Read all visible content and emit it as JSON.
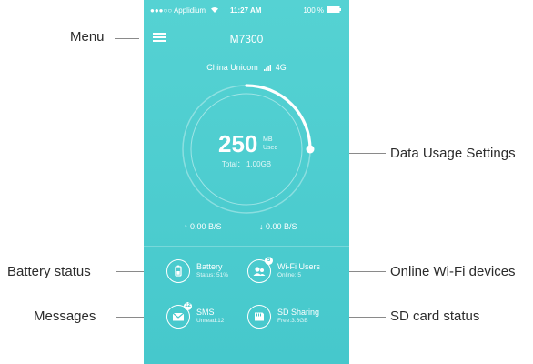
{
  "status_bar": {
    "carrier": "●●●○○ Applidium",
    "time": "11:27 AM",
    "battery": "100 %"
  },
  "header": {
    "title": "M7300"
  },
  "network": {
    "carrier": "China Unicom",
    "type": "4G"
  },
  "usage": {
    "value": "250",
    "unit": "MB",
    "used_label": "Used",
    "total": "Total： 1.00GB",
    "fraction_used": 0.25
  },
  "speeds": {
    "upload": "0.00 B/S",
    "download": "0.00 B/S"
  },
  "tiles": {
    "battery": {
      "label": "Battery",
      "sub": "Status: 51%"
    },
    "wifi": {
      "label": "Wi-Fi Users",
      "sub": "Online: 5",
      "badge": "5"
    },
    "sms": {
      "label": "SMS",
      "sub": "Unread:12",
      "badge": "12"
    },
    "sd": {
      "label": "SD Sharing",
      "sub": "Free:3.6GB"
    }
  },
  "annotations": {
    "menu": "Menu",
    "data_usage": "Data Usage Settings",
    "battery": "Battery status",
    "wifi": "Online Wi-Fi devices",
    "messages": "Messages",
    "sd": "SD card status"
  },
  "colors": {
    "background": "#4ccbce",
    "foreground": "#ffffff"
  }
}
